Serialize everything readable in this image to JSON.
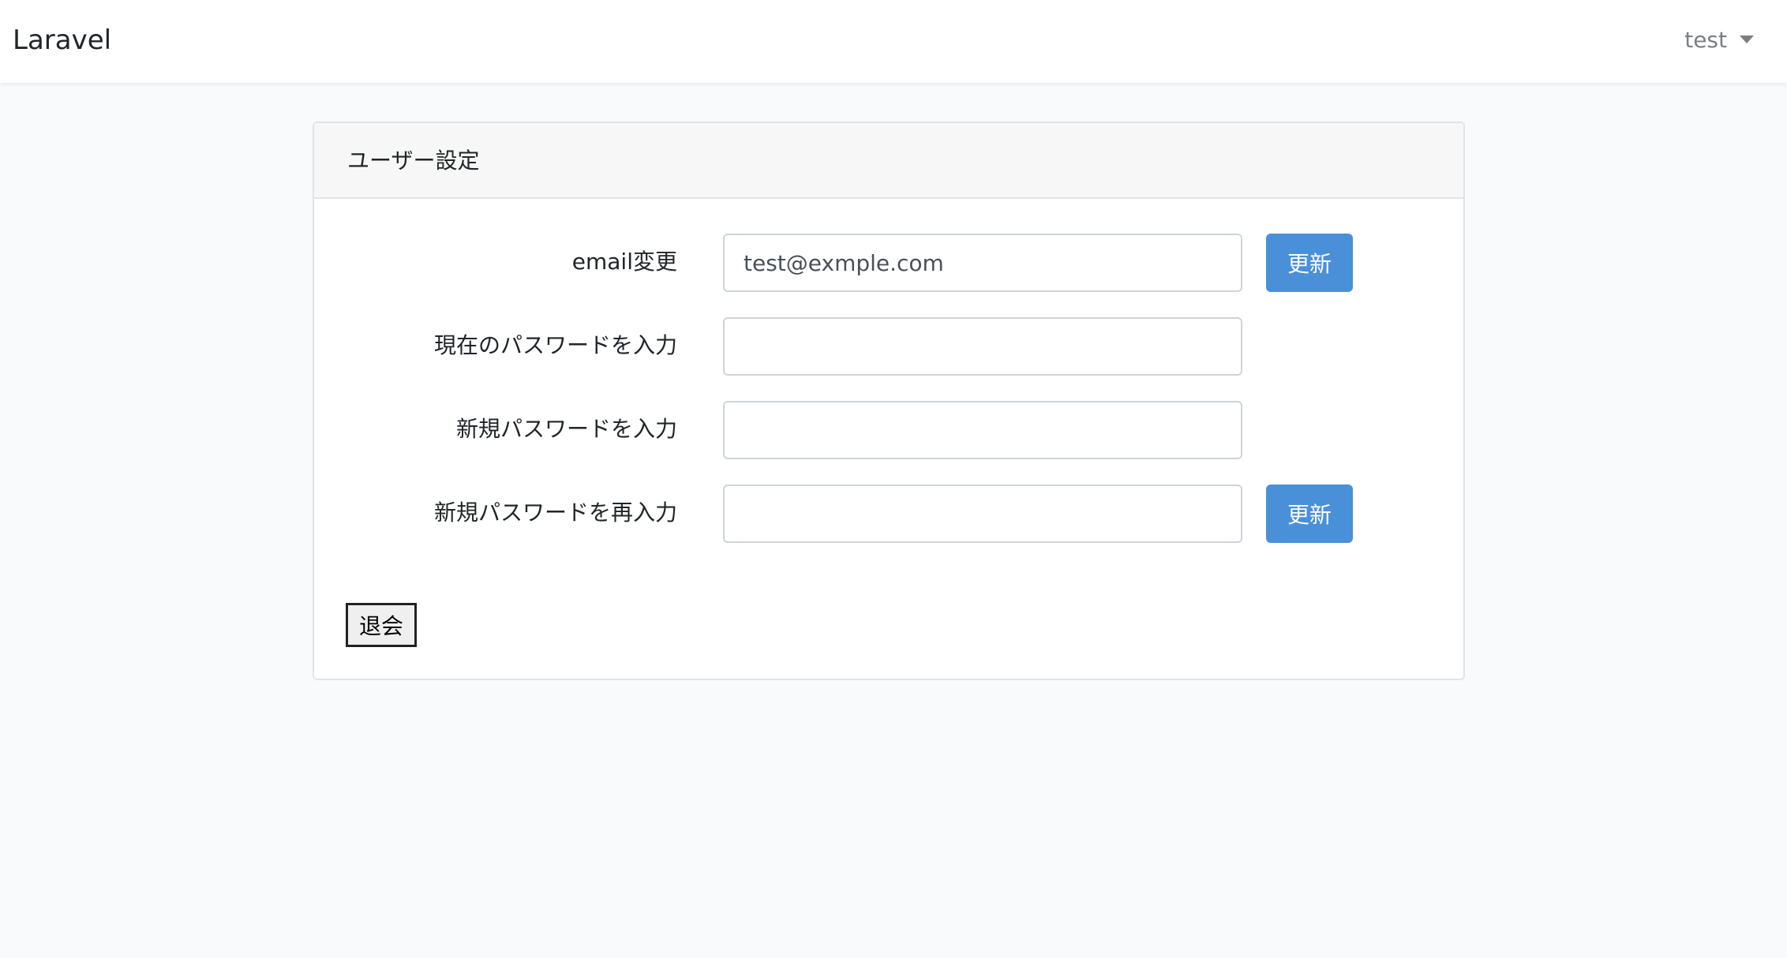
{
  "navbar": {
    "brand": "Laravel",
    "user_name": "test"
  },
  "card": {
    "title": "ユーザー設定",
    "fields": {
      "email": {
        "label": "email変更",
        "value": "test@exmple.com"
      },
      "current_password": {
        "label": "現在のパスワードを入力",
        "value": ""
      },
      "new_password": {
        "label": "新規パスワードを入力",
        "value": ""
      },
      "confirm_password": {
        "label": "新規パスワードを再入力",
        "value": ""
      }
    },
    "email_update_label": "更新",
    "password_update_label": "更新",
    "withdraw_label": "退会"
  },
  "colors": {
    "accent": "#4a90d9",
    "background": "#f8fafc"
  }
}
